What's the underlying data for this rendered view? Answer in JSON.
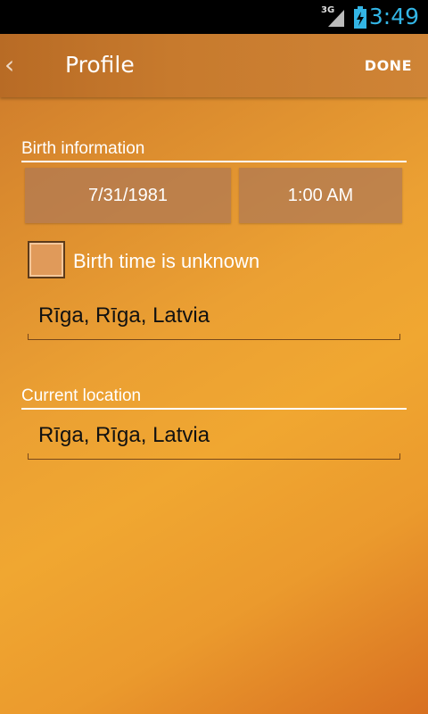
{
  "status_bar": {
    "network": "3G",
    "time": "3:49"
  },
  "action_bar": {
    "back_icon": "chevron-left",
    "title": "Profile",
    "done_label": "DONE"
  },
  "birth_information": {
    "header": "Birth information",
    "date": "7/31/1981",
    "time": "1:00 AM",
    "unknown_time_label": "Birth time is unknown",
    "unknown_time_checked": false,
    "location": "Rīga, Rīga, Latvia"
  },
  "current_location": {
    "header": "Current location",
    "location": "Rīga, Rīga, Latvia"
  },
  "colors": {
    "accent": "#33b5e5",
    "action_bar": "#c77a2d",
    "picker_bg": "#b07855"
  }
}
